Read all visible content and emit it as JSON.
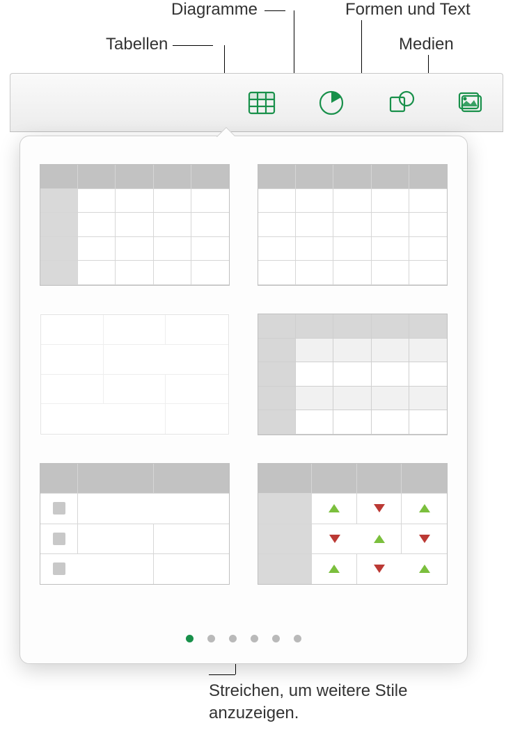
{
  "callouts": {
    "tables": "Tabellen",
    "charts": "Diagramme",
    "shapes": "Formen und Text",
    "media": "Medien"
  },
  "toolbar": {
    "tables_icon": "table-icon",
    "charts_icon": "pie-chart-icon",
    "shapes_icon": "shape-icon",
    "media_icon": "image-icon"
  },
  "popover": {
    "page_count": 6,
    "active_page": 1,
    "swipe_hint": "Streichen, um weitere Stile anzuzeigen."
  }
}
